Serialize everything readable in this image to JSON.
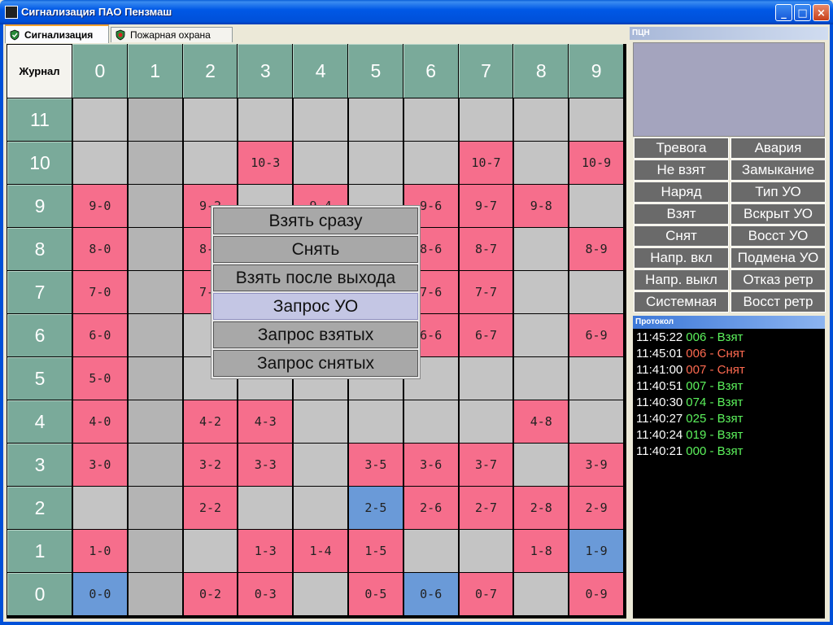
{
  "window": {
    "title": "Сигнализация ПАО Пензмаш",
    "min": "_",
    "max": "□",
    "close": "×"
  },
  "tabs": [
    {
      "label": "Сигнализация",
      "active": true
    },
    {
      "label": "Пожарная охрана",
      "active": false
    }
  ],
  "grid": {
    "corner_label": "Журнал",
    "columns": [
      "0",
      "1",
      "2",
      "3",
      "4",
      "5",
      "6",
      "7",
      "8",
      "9"
    ],
    "rows": [
      {
        "label": "11",
        "cells": [
          {
            "t": "",
            "c": "gray"
          },
          {
            "t": "",
            "c": "dark"
          },
          {
            "t": "",
            "c": "gray"
          },
          {
            "t": "",
            "c": "gray"
          },
          {
            "t": "",
            "c": "gray"
          },
          {
            "t": "",
            "c": "gray"
          },
          {
            "t": "",
            "c": "gray"
          },
          {
            "t": "",
            "c": "gray"
          },
          {
            "t": "",
            "c": "gray"
          },
          {
            "t": "",
            "c": "gray"
          }
        ]
      },
      {
        "label": "10",
        "cells": [
          {
            "t": "",
            "c": "gray"
          },
          {
            "t": "",
            "c": "dark"
          },
          {
            "t": "",
            "c": "gray"
          },
          {
            "t": "10-3",
            "c": "pink"
          },
          {
            "t": "",
            "c": "gray"
          },
          {
            "t": "",
            "c": "gray"
          },
          {
            "t": "",
            "c": "gray"
          },
          {
            "t": "10-7",
            "c": "pink"
          },
          {
            "t": "",
            "c": "gray"
          },
          {
            "t": "10-9",
            "c": "pink"
          }
        ]
      },
      {
        "label": "9",
        "cells": [
          {
            "t": "9-0",
            "c": "pink"
          },
          {
            "t": "",
            "c": "dark"
          },
          {
            "t": "9-2",
            "c": "pink"
          },
          {
            "t": "",
            "c": "gray"
          },
          {
            "t": "9-4",
            "c": "pink"
          },
          {
            "t": "",
            "c": "gray"
          },
          {
            "t": "9-6",
            "c": "pink"
          },
          {
            "t": "9-7",
            "c": "pink"
          },
          {
            "t": "9-8",
            "c": "pink"
          },
          {
            "t": "",
            "c": "gray"
          }
        ]
      },
      {
        "label": "8",
        "cells": [
          {
            "t": "8-0",
            "c": "pink"
          },
          {
            "t": "",
            "c": "dark"
          },
          {
            "t": "8-2",
            "c": "pink"
          },
          {
            "t": "",
            "c": "gray"
          },
          {
            "t": "",
            "c": "gray"
          },
          {
            "t": "",
            "c": "gray"
          },
          {
            "t": "8-6",
            "c": "pink"
          },
          {
            "t": "8-7",
            "c": "pink"
          },
          {
            "t": "",
            "c": "gray"
          },
          {
            "t": "8-9",
            "c": "pink"
          }
        ]
      },
      {
        "label": "7",
        "cells": [
          {
            "t": "7-0",
            "c": "pink"
          },
          {
            "t": "",
            "c": "dark"
          },
          {
            "t": "7-2",
            "c": "pink"
          },
          {
            "t": "",
            "c": "gray"
          },
          {
            "t": "",
            "c": "gray"
          },
          {
            "t": "",
            "c": "gray"
          },
          {
            "t": "7-6",
            "c": "pink"
          },
          {
            "t": "7-7",
            "c": "pink"
          },
          {
            "t": "",
            "c": "gray"
          },
          {
            "t": "",
            "c": "gray"
          }
        ]
      },
      {
        "label": "6",
        "cells": [
          {
            "t": "6-0",
            "c": "pink"
          },
          {
            "t": "",
            "c": "dark"
          },
          {
            "t": "",
            "c": "gray"
          },
          {
            "t": "",
            "c": "gray"
          },
          {
            "t": "",
            "c": "gray"
          },
          {
            "t": "",
            "c": "gray"
          },
          {
            "t": "6-6",
            "c": "pink"
          },
          {
            "t": "6-7",
            "c": "pink"
          },
          {
            "t": "",
            "c": "gray"
          },
          {
            "t": "6-9",
            "c": "pink"
          }
        ]
      },
      {
        "label": "5",
        "cells": [
          {
            "t": "5-0",
            "c": "pink"
          },
          {
            "t": "",
            "c": "dark"
          },
          {
            "t": "",
            "c": "gray"
          },
          {
            "t": "",
            "c": "gray"
          },
          {
            "t": "",
            "c": "gray"
          },
          {
            "t": "",
            "c": "gray"
          },
          {
            "t": "",
            "c": "gray"
          },
          {
            "t": "",
            "c": "gray"
          },
          {
            "t": "",
            "c": "gray"
          },
          {
            "t": "",
            "c": "gray"
          }
        ]
      },
      {
        "label": "4",
        "cells": [
          {
            "t": "4-0",
            "c": "pink"
          },
          {
            "t": "",
            "c": "dark"
          },
          {
            "t": "4-2",
            "c": "pink"
          },
          {
            "t": "4-3",
            "c": "pink"
          },
          {
            "t": "",
            "c": "gray"
          },
          {
            "t": "",
            "c": "gray"
          },
          {
            "t": "",
            "c": "gray"
          },
          {
            "t": "",
            "c": "gray"
          },
          {
            "t": "4-8",
            "c": "pink"
          },
          {
            "t": "",
            "c": "gray"
          }
        ]
      },
      {
        "label": "3",
        "cells": [
          {
            "t": "3-0",
            "c": "pink"
          },
          {
            "t": "",
            "c": "dark"
          },
          {
            "t": "3-2",
            "c": "pink"
          },
          {
            "t": "3-3",
            "c": "pink"
          },
          {
            "t": "",
            "c": "gray"
          },
          {
            "t": "3-5",
            "c": "pink"
          },
          {
            "t": "3-6",
            "c": "pink"
          },
          {
            "t": "3-7",
            "c": "pink"
          },
          {
            "t": "",
            "c": "gray"
          },
          {
            "t": "3-9",
            "c": "pink"
          }
        ]
      },
      {
        "label": "2",
        "cells": [
          {
            "t": "",
            "c": "gray"
          },
          {
            "t": "",
            "c": "dark"
          },
          {
            "t": "2-2",
            "c": "pink"
          },
          {
            "t": "",
            "c": "gray"
          },
          {
            "t": "",
            "c": "gray"
          },
          {
            "t": "2-5",
            "c": "blue"
          },
          {
            "t": "2-6",
            "c": "pink"
          },
          {
            "t": "2-7",
            "c": "pink"
          },
          {
            "t": "2-8",
            "c": "pink"
          },
          {
            "t": "2-9",
            "c": "pink"
          }
        ]
      },
      {
        "label": "1",
        "cells": [
          {
            "t": "1-0",
            "c": "pink"
          },
          {
            "t": "",
            "c": "dark"
          },
          {
            "t": "",
            "c": "gray"
          },
          {
            "t": "1-3",
            "c": "pink"
          },
          {
            "t": "1-4",
            "c": "pink"
          },
          {
            "t": "1-5",
            "c": "pink"
          },
          {
            "t": "",
            "c": "gray"
          },
          {
            "t": "",
            "c": "gray"
          },
          {
            "t": "1-8",
            "c": "pink"
          },
          {
            "t": "1-9",
            "c": "blue"
          }
        ]
      },
      {
        "label": "0",
        "cells": [
          {
            "t": "0-0",
            "c": "blue"
          },
          {
            "t": "",
            "c": "dark"
          },
          {
            "t": "0-2",
            "c": "pink"
          },
          {
            "t": "0-3",
            "c": "pink"
          },
          {
            "t": "",
            "c": "gray"
          },
          {
            "t": "0-5",
            "c": "pink"
          },
          {
            "t": "0-6",
            "c": "blue"
          },
          {
            "t": "0-7",
            "c": "pink"
          },
          {
            "t": "",
            "c": "gray"
          },
          {
            "t": "0-9",
            "c": "pink"
          }
        ]
      }
    ]
  },
  "context_menu": {
    "items": [
      "Взять сразу",
      "Снять",
      "Взять после выхода",
      "Запрос УО",
      "Запрос взятых",
      "Запрос снятых"
    ],
    "highlighted": "Запрос УО"
  },
  "right_panel": {
    "pcn_title": "ПЦН",
    "events": [
      "Тревога",
      "Авария",
      "Не взят",
      "Замыкание",
      "Наряд",
      "Тип УО",
      "Взят",
      "Вскрыт УО",
      "Снят",
      "Восст УО",
      "Напр. вкл",
      "Подмена УО",
      "Напр. выкл",
      "Отказ ретр",
      "Системная",
      "Восст ретр"
    ],
    "protocol_title": "Протокол",
    "protocol": [
      {
        "time": "11:45:22",
        "msg": "006 - Взят",
        "color": "#5cf25c"
      },
      {
        "time": "11:45:01",
        "msg": "006 - Снят",
        "color": "#ff6a50"
      },
      {
        "time": "11:41:00",
        "msg": "007 - Снят",
        "color": "#ff6a50"
      },
      {
        "time": "11:40:51",
        "msg": "007 - Взят",
        "color": "#5cf25c"
      },
      {
        "time": "11:40:30",
        "msg": "074 - Взят",
        "color": "#5cf25c"
      },
      {
        "time": "11:40:27",
        "msg": "025 - Взят",
        "color": "#5cf25c"
      },
      {
        "time": "11:40:24",
        "msg": "019 - Взят",
        "color": "#5cf25c"
      },
      {
        "time": "11:40:21",
        "msg": "000 - Взят",
        "color": "#5cf25c"
      }
    ]
  }
}
